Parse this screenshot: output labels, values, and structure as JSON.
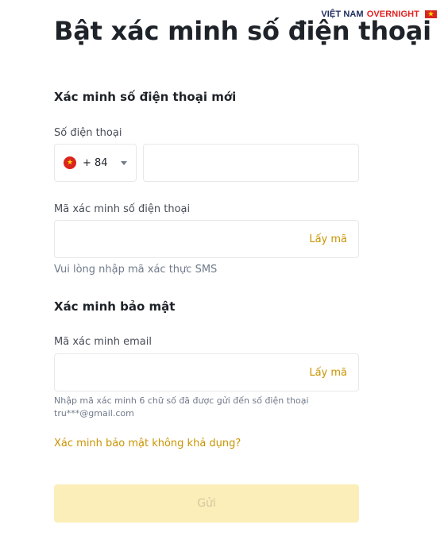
{
  "watermark": {
    "part1": "VIỆT NAM",
    "part2": "OVERNIGHT",
    "flag_icon": "vietnam-flag-icon"
  },
  "page": {
    "title": "Bật xác minh số điện thoại"
  },
  "new_phone_section": {
    "title": "Xác minh số điện thoại mới",
    "phone_label": "Số điện thoại",
    "country_code": "+ 84",
    "phone_value": "",
    "code_label": "Mã xác minh số điện thoại",
    "code_value": "",
    "get_code": "Lấy mã",
    "helper": "Vui lòng nhập mã xác thực SMS"
  },
  "security_section": {
    "title": "Xác minh bảo mật",
    "email_label": "Mã xác minh email",
    "email_value": "",
    "get_code": "Lấy mã",
    "helper_line1": "Nhập mã xác minh 6 chữ số đã được gửi đến số điện thoại",
    "helper_line2": "tru***@gmail.com",
    "unavailable_link": "Xác minh bảo mật không khả dụng?"
  },
  "submit": {
    "label": "Gửi",
    "enabled": false
  },
  "colors": {
    "accent": "#c99400",
    "button_disabled_bg": "#fbeeb8",
    "title": "#1e2329"
  }
}
